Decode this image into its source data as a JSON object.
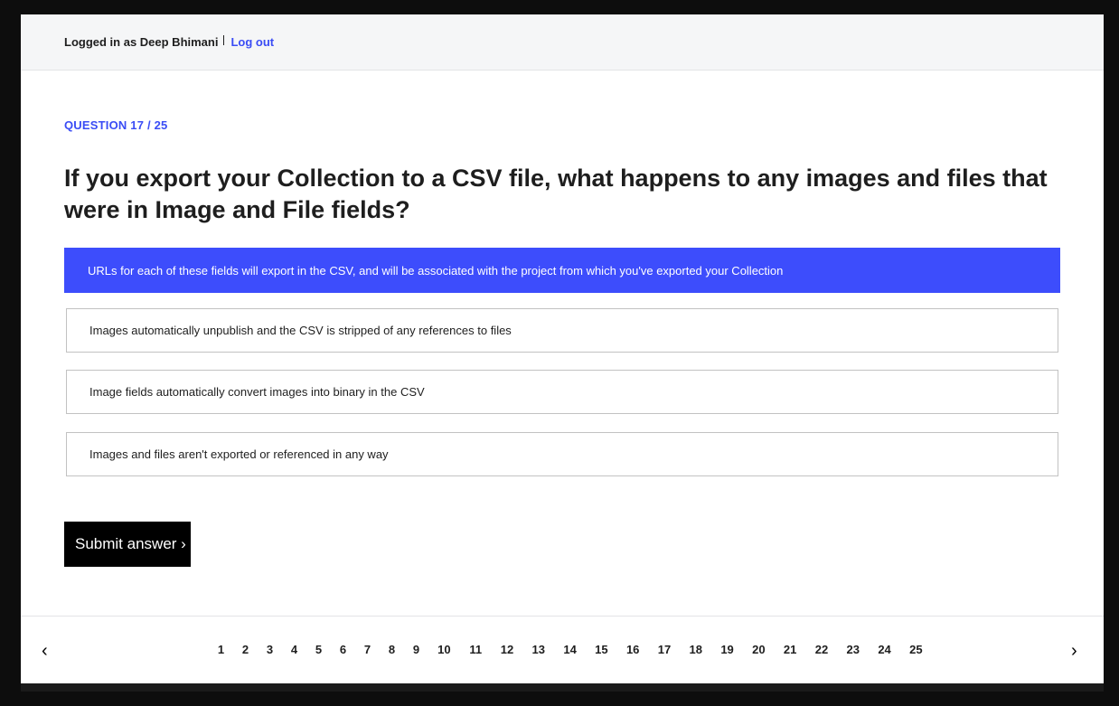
{
  "header": {
    "user_text": "Logged in as Deep Bhimani",
    "logout_label": "Log out"
  },
  "question": {
    "number_label": "QUESTION 17 / 25",
    "text": "If you export your Collection to a CSV file, what happens to any images and files that were in Image and File fields?"
  },
  "options": [
    {
      "label": "URLs for each of these fields will export in the CSV, and will be associated with the project from which you've exported your Collection",
      "selected": true
    },
    {
      "label": "Images automatically unpublish and the CSV is stripped of any references to files",
      "selected": false
    },
    {
      "label": "Image fields automatically convert images into binary in the CSV",
      "selected": false
    },
    {
      "label": "Images and files aren't exported or referenced in any way",
      "selected": false
    }
  ],
  "submit_label": "Submit answer ›",
  "pagination": {
    "prev_icon": "‹",
    "next_icon": "›",
    "pages": [
      "1",
      "2",
      "3",
      "4",
      "5",
      "6",
      "7",
      "8",
      "9",
      "10",
      "11",
      "12",
      "13",
      "14",
      "15",
      "16",
      "17",
      "18",
      "19",
      "20",
      "21",
      "22",
      "23",
      "24",
      "25"
    ]
  },
  "colors": {
    "accent": "#3d4dfc",
    "link": "#3a4cf5",
    "button": "#000000"
  }
}
